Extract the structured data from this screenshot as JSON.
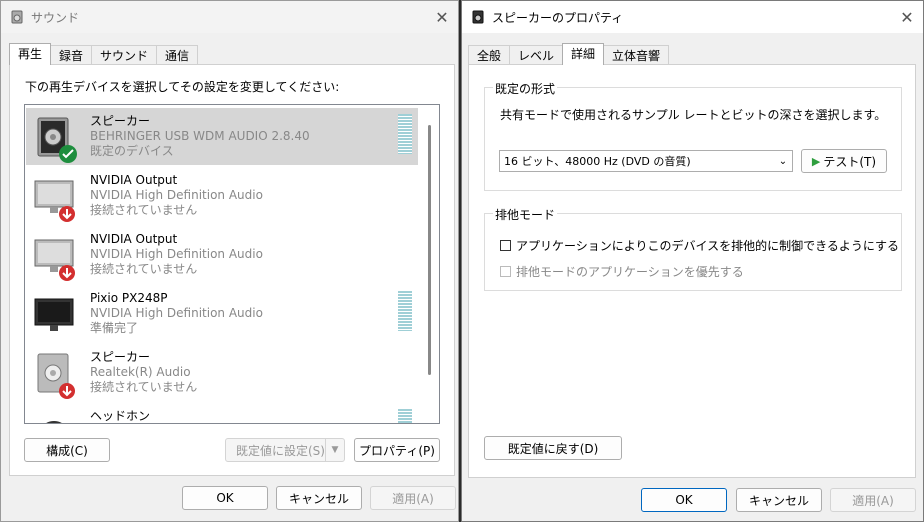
{
  "sound_window": {
    "title": "サウンド",
    "tabs": [
      "再生",
      "録音",
      "サウンド",
      "通信"
    ],
    "instruction": "下の再生デバイスを選択してその設定を変更してください:",
    "devices": [
      {
        "name": "スピーカー",
        "driver": "BEHRINGER USB WDM AUDIO 2.8.40",
        "status": "既定のデバイス",
        "icon": "speaker-icon",
        "badge": "default-check-icon"
      },
      {
        "name": "NVIDIA Output",
        "driver": "NVIDIA High Definition Audio",
        "status": "接続されていません",
        "icon": "monitor-icon",
        "badge": "disconnected-arrow-icon"
      },
      {
        "name": "NVIDIA Output",
        "driver": "NVIDIA High Definition Audio",
        "status": "接続されていません",
        "icon": "monitor-icon",
        "badge": "disconnected-arrow-icon"
      },
      {
        "name": "Pixio PX248P",
        "driver": "NVIDIA High Definition Audio",
        "status": "準備完了",
        "icon": "monitor-icon",
        "badge": ""
      },
      {
        "name": "スピーカー",
        "driver": "Realtek(R) Audio",
        "status": "接続されていません",
        "icon": "speaker-icon",
        "badge": "disconnected-arrow-icon"
      },
      {
        "name": "ヘッドホン",
        "driver": "",
        "status": "",
        "icon": "headphones-icon",
        "badge": ""
      }
    ],
    "configure_label": "構成(C)",
    "set_default_label": "既定値に設定(S)",
    "properties_label": "プロパティ(P)",
    "ok_label": "OK",
    "cancel_label": "キャンセル",
    "apply_label": "適用(A)"
  },
  "props_window": {
    "title": "スピーカーのプロパティ",
    "tabs": [
      "全般",
      "レベル",
      "詳細",
      "立体音響"
    ],
    "active_tab": "詳細",
    "default_format": {
      "group_title": "既定の形式",
      "description": "共有モードで使用されるサンプル レートとビットの深さを選択します。",
      "selected_format": "16 ビット、48000 Hz (DVD の音質)",
      "test_label": "テスト(T)"
    },
    "exclusive_mode": {
      "group_title": "排他モード",
      "allow_label": "アプリケーションによりこのデバイスを排他的に制御できるようにする",
      "priority_label": "排他モードのアプリケーションを優先する"
    },
    "restore_defaults_label": "既定値に戻す(D)",
    "ok_label": "OK",
    "cancel_label": "キャンセル",
    "apply_label": "適用(A)"
  },
  "colors": {
    "accent": "#0067c0",
    "default_check": "#1e8e3e",
    "disconnected": "#d32f2f",
    "test_play": "#2e9e3e"
  }
}
